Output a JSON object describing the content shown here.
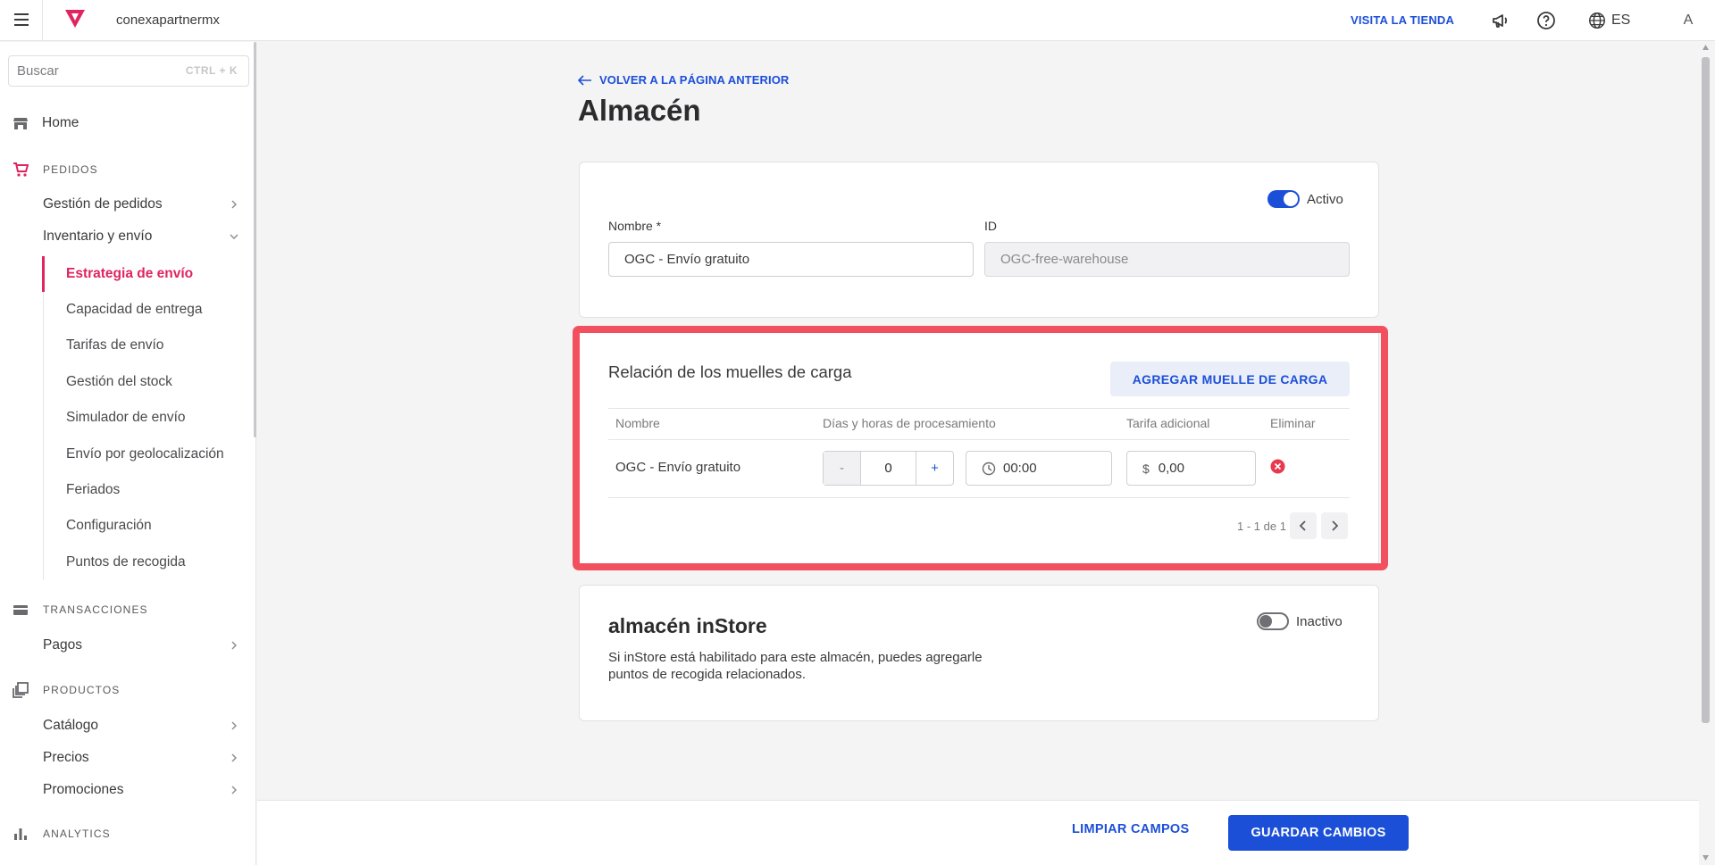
{
  "topbar": {
    "account": "conexapartnermx",
    "visit_store": "VISITA LA TIENDA",
    "language": "ES",
    "avatar_initial": "A"
  },
  "sidebar": {
    "search_placeholder": "Buscar",
    "search_shortcut": "CTRL + K",
    "home": "Home",
    "section_orders": "PEDIDOS",
    "order_management": "Gestión de pedidos",
    "inventory_shipping": "Inventario y envío",
    "sub_items": [
      "Estrategia de envío",
      "Capacidad de entrega",
      "Tarifas de envío",
      "Gestión del stock",
      "Simulador de envío",
      "Envío por geolocalización",
      "Feriados",
      "Configuración",
      "Puntos de recogida"
    ],
    "section_transactions": "TRANSACCIONES",
    "payments": "Pagos",
    "section_products": "PRODUCTOS",
    "catalog": "Catálogo",
    "prices": "Precios",
    "promotions": "Promociones",
    "section_analytics": "ANALYTICS"
  },
  "page": {
    "back_link": "VOLVER A LA PÁGINA ANTERIOR",
    "title": "Almacén"
  },
  "warehouse": {
    "status_label": "Activo",
    "status_active": true,
    "name_label": "Nombre *",
    "name_value": "OGC - Envío gratuito",
    "id_label": "ID",
    "id_value": "OGC-free-warehouse"
  },
  "docks": {
    "title": "Relación de los muelles de carga",
    "add_button": "AGREGAR MUELLE DE CARGA",
    "columns": [
      "Nombre",
      "Días y horas de procesamiento",
      "Tarifa adicional",
      "Eliminar"
    ],
    "rows": [
      {
        "name": "OGC - Envío gratuito",
        "days": "0",
        "minus": "-",
        "plus": "+",
        "time": "00:00",
        "currency": "$",
        "fee": "0,00"
      }
    ],
    "pagination": "1 - 1 de 1"
  },
  "instore": {
    "title": "almacén inStore",
    "status_label": "Inactivo",
    "status_active": false,
    "description": "Si inStore está habilitado para este almacén, puedes agregarle puntos de recogida relacionados."
  },
  "footer": {
    "clear": "LIMPIAR CAMPOS",
    "save": "GUARDAR CAMBIOS"
  },
  "colors": {
    "accent": "#1c4fd8",
    "brand": "#e0245e",
    "highlight": "#f2505f",
    "delete": "#e8394d"
  }
}
